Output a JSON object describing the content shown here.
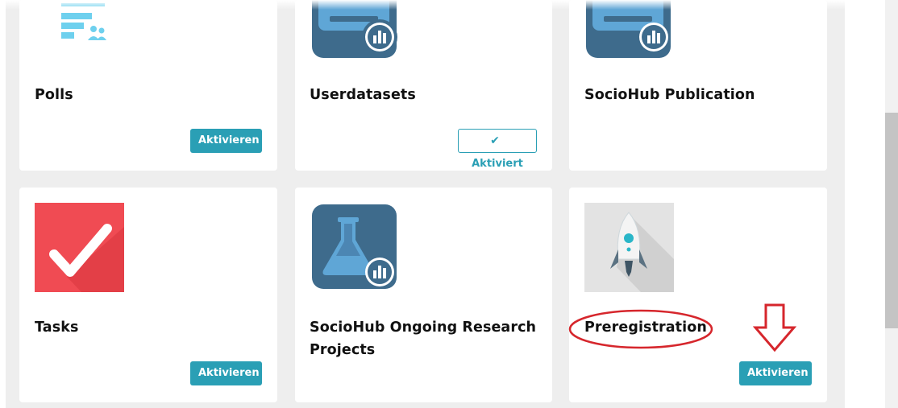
{
  "cards": [
    {
      "title": "Polls",
      "icon": "polls-icon",
      "button": "Aktivieren"
    },
    {
      "title": "Userdatasets",
      "icon": "dataset-icon",
      "button": "Aktiviert",
      "button_check": "✔"
    },
    {
      "title": "SocioHub Publication",
      "icon": "dataset-icon"
    },
    {
      "title": "Tasks",
      "icon": "checkmark-icon",
      "button": "Aktivieren"
    },
    {
      "title_lines": [
        "SocioHub Ongoing Research",
        "Projects"
      ],
      "icon": "flask-icon"
    },
    {
      "title": "Preregistration",
      "icon": "rocket-icon",
      "button": "Aktivieren"
    }
  ],
  "colors": {
    "accent": "#2a9fb5",
    "annotation": "#d6262c",
    "tasks_icon": "#f04b53",
    "dataset_icon": "#3e6b8c"
  }
}
